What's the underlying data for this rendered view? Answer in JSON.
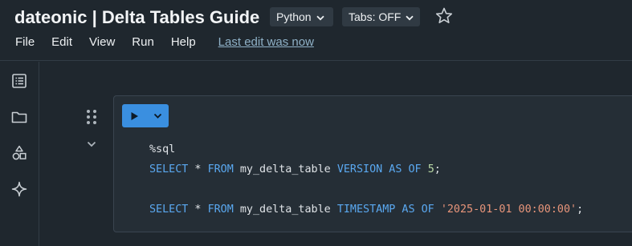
{
  "app": {
    "title": "dateonic | Delta Tables Guide",
    "language_label": "Python",
    "tabs_label": "Tabs: OFF",
    "favorite_icon": "star-icon"
  },
  "menu": {
    "items": [
      "File",
      "Edit",
      "View",
      "Run",
      "Help"
    ],
    "last_edit": "Last edit was now"
  },
  "sidebar": {
    "icons": [
      "table-of-contents-icon",
      "folder-icon",
      "shapes-icon",
      "sparkle-icon"
    ]
  },
  "cell": {
    "run_icon": "play-icon",
    "run_menu_icon": "chevron-down-icon",
    "code_lines": [
      [
        {
          "t": "%sql",
          "c": "plain"
        }
      ],
      [
        {
          "t": "SELECT",
          "c": "kw"
        },
        {
          "t": " * ",
          "c": "plain"
        },
        {
          "t": "FROM",
          "c": "kw"
        },
        {
          "t": " my_delta_table ",
          "c": "plain"
        },
        {
          "t": "VERSION AS OF",
          "c": "kw"
        },
        {
          "t": " ",
          "c": "plain"
        },
        {
          "t": "5",
          "c": "num"
        },
        {
          "t": ";",
          "c": "plain"
        }
      ],
      [],
      [
        {
          "t": "SELECT",
          "c": "kw"
        },
        {
          "t": " * ",
          "c": "plain"
        },
        {
          "t": "FROM",
          "c": "kw"
        },
        {
          "t": " my_delta_table ",
          "c": "plain"
        },
        {
          "t": "TIMESTAMP AS OF",
          "c": "kw"
        },
        {
          "t": " ",
          "c": "plain"
        },
        {
          "t": "'2025-01-01 00:00:00'",
          "c": "str"
        },
        {
          "t": ";",
          "c": "plain"
        }
      ]
    ]
  },
  "colors": {
    "background": "#1f272e",
    "cell_background": "#252e36",
    "run_button": "#3a8fe0",
    "keyword": "#5aa8f0",
    "string": "#e8957a"
  }
}
